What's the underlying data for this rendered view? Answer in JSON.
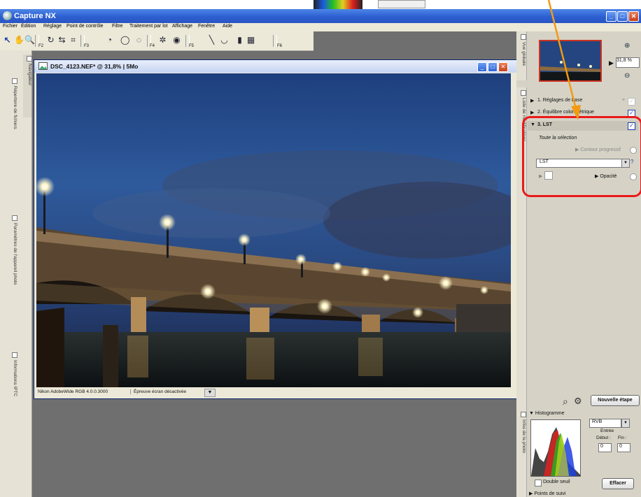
{
  "app": {
    "title": "Capture NX"
  },
  "menu": [
    "Fichier",
    "Édition",
    "Réglage",
    "Point de contrôle",
    "Filtre",
    "Traitement par lot",
    "Affichage",
    "Fenêtre",
    "Aide"
  ],
  "toolbar": {
    "f_labels": [
      "F2",
      "F3",
      "F4",
      "F5",
      "F6"
    ]
  },
  "left_tabs": {
    "navigator": "Navigateur",
    "files": "Répertoire de fichiers",
    "camera": "Paramètres de l'appareil photo",
    "iptc": "Informations IPTC"
  },
  "image_window": {
    "title": "DSC_4123.NEF* @ 31,8% | 5Mo",
    "profile": "Nikon AdobeWide RGB 4.0.0.3000",
    "proof": "Épreuve écran désactivée"
  },
  "right_panel": {
    "overview_tab": "Vue globale",
    "zoom_value": "31,8",
    "zoom_unit": "%",
    "edit_list_tab": "Liste de modifications",
    "steps": [
      {
        "label": "1. Réglages de base",
        "checked": false
      },
      {
        "label": "2. Équilibre colorimétrique",
        "checked": true
      },
      {
        "label": "3. LST",
        "checked": true
      }
    ],
    "selection": "Toute la sélection",
    "contour": "Contour progressif",
    "lst_select": "LST",
    "opacity": "Opacité",
    "new_step_button": "Nouvelle étape",
    "photo_info_tab": "Infos de la photo",
    "histogram": {
      "title": "Histogramme",
      "channel": "RVB",
      "input_label": "Entrée",
      "start_label": "Début :",
      "end_label": "Fin :",
      "start_value": "0",
      "end_value": "0",
      "double_threshold": "Double seuil",
      "clear_button": "Effacer"
    },
    "watch_points": "Points de suivi"
  },
  "colors": {
    "highlight_ring": "#ea1a1a",
    "arrow": "#f39a12",
    "titlebar": "#2c5fd1"
  }
}
